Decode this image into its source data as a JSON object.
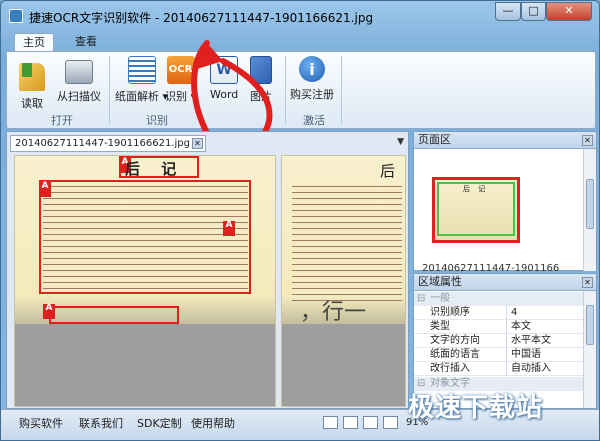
{
  "window": {
    "title": "捷速OCR文字识别软件 - 20140627111447-1901166621.jpg",
    "min": "—",
    "max": "□",
    "close": "✕"
  },
  "tabs": [
    {
      "label": "主页"
    },
    {
      "label": "查看"
    }
  ],
  "ribbon": {
    "buttons": [
      {
        "label": "读取",
        "icon": "folder-icon"
      },
      {
        "label": "从扫描仪",
        "icon": "scanner-icon"
      },
      {
        "label": "纸面解析",
        "icon": "layout-icon"
      },
      {
        "label": "识别",
        "icon": "ocr-icon",
        "icon_text": "OCR"
      },
      {
        "label": "Word",
        "icon": "word-icon",
        "icon_text": "W"
      },
      {
        "label": "图片",
        "icon": "image-icon"
      },
      {
        "label": "购买注册",
        "icon": "info-icon",
        "icon_text": "i"
      }
    ],
    "groups": [
      {
        "label": "打开"
      },
      {
        "label": "识别"
      },
      {
        "label": "激活"
      }
    ]
  },
  "document": {
    "tab_label": "20140627111447-1901166621.jpg",
    "page1_heading": "后 记",
    "page2_heading": "后",
    "page2_bottom": "，行一",
    "region_tag": "A"
  },
  "page_panel": {
    "title": "页面区",
    "thumb_heading": "后 记",
    "thumb_label": "20140627111447-1901166"
  },
  "properties": {
    "title": "区域属性",
    "category_general": "一般",
    "rows": [
      {
        "key": "识别顺序",
        "value": "4"
      },
      {
        "key": "类型",
        "value": "本文"
      },
      {
        "key": "文字的方向",
        "value": "水平本文"
      },
      {
        "key": "纸面的语言",
        "value": "中国语"
      },
      {
        "key": "改行插入",
        "value": "自动插入"
      }
    ],
    "category_object": "对象文字"
  },
  "status": {
    "buy": "购买软件",
    "contact": "联系我们",
    "sdk": "SDK定制",
    "help": "使用帮助",
    "zoom": "91%"
  },
  "watermark": "极速下载站",
  "colors": {
    "accent": "#e0201f",
    "ribbon": "#dde9f5",
    "frame": "#79add9"
  }
}
